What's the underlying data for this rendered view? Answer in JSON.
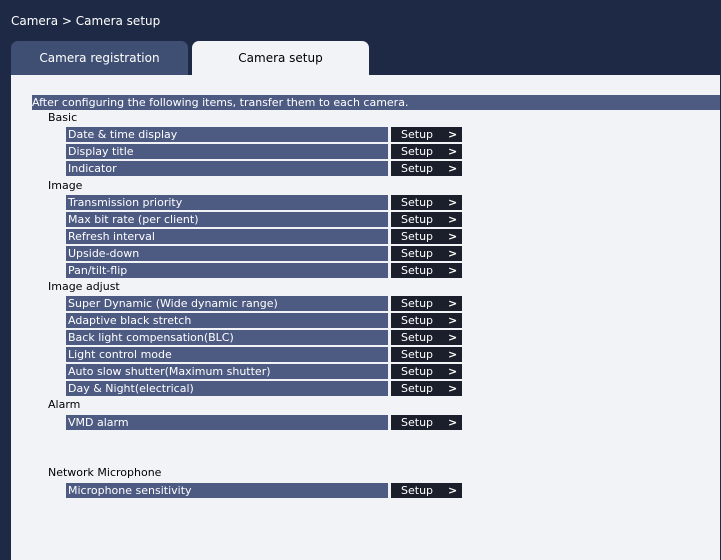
{
  "breadcrumb": "Camera > Camera setup",
  "tabs": {
    "registration": "Camera registration",
    "setup": "Camera setup"
  },
  "header_text": "After configuring the following items, transfer them to each camera.",
  "button_label": "Setup",
  "button_arrow": ">",
  "groups": {
    "basic": {
      "title": "Basic",
      "items": [
        "Date & time display",
        "Display title",
        "Indicator"
      ]
    },
    "image": {
      "title": "Image",
      "items": [
        "Transmission priority",
        "Max bit rate (per client)",
        "Refresh interval",
        "Upside-down",
        "Pan/tilt-flip"
      ]
    },
    "image_adjust": {
      "title": "Image adjust",
      "items": [
        "Super Dynamic (Wide dynamic range)",
        "Adaptive black stretch",
        "Back light compensation(BLC)",
        "Light control mode",
        "Auto slow shutter(Maximum shutter)",
        "Day & Night(electrical)"
      ]
    },
    "alarm": {
      "title": "Alarm",
      "items": [
        "VMD alarm"
      ]
    },
    "network_microphone": {
      "title": "Network Microphone",
      "items": [
        "Microphone sensitivity"
      ]
    }
  }
}
